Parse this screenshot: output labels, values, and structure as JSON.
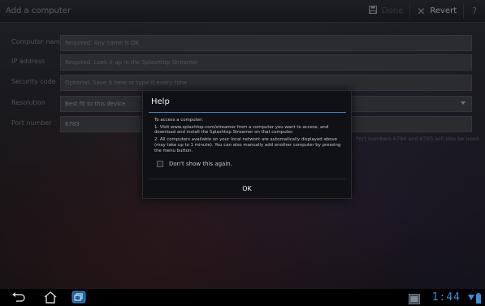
{
  "actionbar": {
    "title": "Add a computer",
    "done_label": "Done",
    "revert_label": "Revert",
    "help_label": "?"
  },
  "form": {
    "rows": [
      {
        "label": "Computer name",
        "placeholder": "Required. Any name is OK"
      },
      {
        "label": "IP address",
        "placeholder": "Required. Look it up in the Splashtop Streamer"
      },
      {
        "label": "Security code",
        "placeholder": "Optional. Save it here or type it every time"
      },
      {
        "label": "Resolution",
        "value": "Best fit to this device"
      },
      {
        "label": "Port number",
        "value": "6783"
      }
    ],
    "port_note": "Port numbers 6784 and 6785 will also be used."
  },
  "dialog": {
    "title": "Help",
    "intro": "To access a computer:",
    "step1": "1. Visit www.splashtop.com/streamer from a computer you want to access, and download and install the Splashtop Streamer on that computer.",
    "step2": "2. All computers available on your local network are automatically displayed above (may take up to 1 minute). You can also manually add another computer by pressing the menu button.",
    "checkbox_label": "Don't show this again.",
    "ok_label": "OK"
  },
  "systembar": {
    "time": "1:44"
  },
  "colors": {
    "accent": "#2f86c7",
    "clock": "#3a8ed6"
  }
}
